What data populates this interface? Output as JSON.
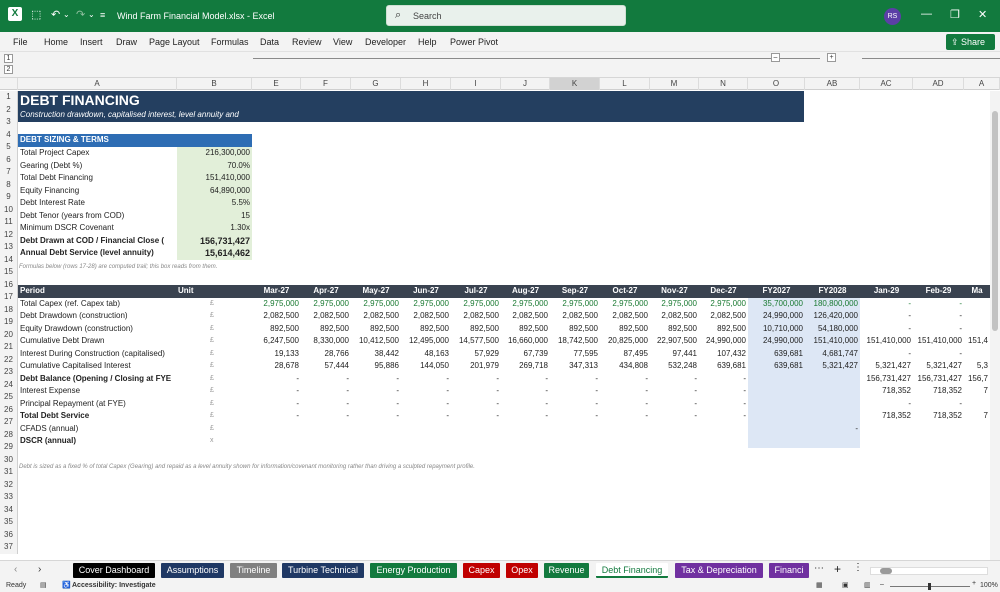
{
  "window": {
    "title": "Wind Farm Financial Model.xlsx  -  Excel",
    "avatar": "RS"
  },
  "search": {
    "placeholder": "Search"
  },
  "menu": [
    "File",
    "Home",
    "Insert",
    "Draw",
    "Page Layout",
    "Formulas",
    "Data",
    "Review",
    "View",
    "Developer",
    "Help",
    "Power Pivot"
  ],
  "share_label": "Share",
  "columns": [
    "A",
    "B",
    "E",
    "F",
    "G",
    "H",
    "I",
    "J",
    "K",
    "L",
    "M",
    "N",
    "O",
    "AB",
    "AC",
    "AD",
    "A"
  ],
  "selected_column": "K",
  "outline": {
    "levels": [
      "1",
      "2"
    ],
    "collapse": "–",
    "expand": "+"
  },
  "sheet": {
    "title": "DEBT FINANCING",
    "subtitle": "Construction drawdown, capitalised interest, level annuity and",
    "section_sizing": "DEBT SIZING & TERMS",
    "terms": [
      {
        "label": "Total Project Capex",
        "value": "216,300,000",
        "bold": false
      },
      {
        "label": "Gearing (Debt %)",
        "value": "70.0%",
        "bold": false
      },
      {
        "label": "Total Debt Financing",
        "value": "151,410,000",
        "bold": false
      },
      {
        "label": "Equity Financing",
        "value": "64,890,000",
        "bold": false
      },
      {
        "label": "Debt Interest Rate",
        "value": "5.5%",
        "bold": false
      },
      {
        "label": "Debt Tenor (years from COD)",
        "value": "15",
        "bold": false
      },
      {
        "label": "Minimum DSCR Covenant",
        "value": "1.30x",
        "bold": false
      },
      {
        "label": "Debt Drawn at COD / Financial Close (",
        "value": "156,731,427",
        "bold": true
      },
      {
        "label": "Annual Debt Service (level annuity)",
        "value": "15,614,462",
        "bold": true
      }
    ],
    "note_row14": "Formulas below (rows 17-28) are computed trail; this box reads from them.",
    "period_label": "Period",
    "unit_label": "Unit",
    "periods": [
      "Mar-27",
      "Apr-27",
      "May-27",
      "Jun-27",
      "Jul-27",
      "Aug-27",
      "Sep-27",
      "Oct-27",
      "Nov-27",
      "Dec-27",
      "FY2027",
      "FY2028",
      "Jan-29",
      "Feb-29",
      "Ma"
    ],
    "rows": [
      {
        "label": "Total Capex (ref. Capex tab)",
        "unit": "£",
        "bold": false,
        "green": true,
        "values": [
          "2,975,000",
          "2,975,000",
          "2,975,000",
          "2,975,000",
          "2,975,000",
          "2,975,000",
          "2,975,000",
          "2,975,000",
          "2,975,000",
          "2,975,000",
          "35,700,000",
          "180,800,000",
          "-",
          "-",
          ""
        ]
      },
      {
        "label": "Debt Drawdown (construction)",
        "unit": "£",
        "bold": false,
        "green": false,
        "values": [
          "2,082,500",
          "2,082,500",
          "2,082,500",
          "2,082,500",
          "2,082,500",
          "2,082,500",
          "2,082,500",
          "2,082,500",
          "2,082,500",
          "2,082,500",
          "24,990,000",
          "126,420,000",
          "-",
          "-",
          ""
        ]
      },
      {
        "label": "Equity Drawdown (construction)",
        "unit": "£",
        "bold": false,
        "green": false,
        "values": [
          "892,500",
          "892,500",
          "892,500",
          "892,500",
          "892,500",
          "892,500",
          "892,500",
          "892,500",
          "892,500",
          "892,500",
          "10,710,000",
          "54,180,000",
          "-",
          "-",
          ""
        ]
      },
      {
        "label": "Cumulative Debt Drawn",
        "unit": "£",
        "bold": false,
        "green": false,
        "values": [
          "6,247,500",
          "8,330,000",
          "10,412,500",
          "12,495,000",
          "14,577,500",
          "16,660,000",
          "18,742,500",
          "20,825,000",
          "22,907,500",
          "24,990,000",
          "24,990,000",
          "151,410,000",
          "151,410,000",
          "151,410,000",
          "151,4"
        ]
      },
      {
        "label": "Interest During Construction (capitalised)",
        "unit": "£",
        "bold": false,
        "green": false,
        "values": [
          "19,133",
          "28,766",
          "38,442",
          "48,163",
          "57,929",
          "67,739",
          "77,595",
          "87,495",
          "97,441",
          "107,432",
          "639,681",
          "4,681,747",
          "-",
          "-",
          ""
        ]
      },
      {
        "label": "Cumulative Capitalised Interest",
        "unit": "£",
        "bold": false,
        "green": false,
        "values": [
          "28,678",
          "57,444",
          "95,886",
          "144,050",
          "201,979",
          "269,718",
          "347,313",
          "434,808",
          "532,248",
          "639,681",
          "639,681",
          "5,321,427",
          "5,321,427",
          "5,321,427",
          "5,3"
        ]
      },
      {
        "label": "Debt Balance (Opening / Closing at FYE",
        "unit": "£",
        "bold": true,
        "green": false,
        "values": [
          "-",
          "-",
          "-",
          "-",
          "-",
          "-",
          "-",
          "-",
          "-",
          "-",
          "",
          "",
          "156,731,427",
          "156,731,427",
          "156,7"
        ]
      },
      {
        "label": "Interest Expense",
        "unit": "£",
        "bold": false,
        "green": false,
        "values": [
          "-",
          "-",
          "-",
          "-",
          "-",
          "-",
          "-",
          "-",
          "-",
          "-",
          "",
          "",
          "718,352",
          "718,352",
          "7"
        ]
      },
      {
        "label": "Principal Repayment (at FYE)",
        "unit": "£",
        "bold": false,
        "green": false,
        "values": [
          "-",
          "-",
          "-",
          "-",
          "-",
          "-",
          "-",
          "-",
          "-",
          "-",
          "",
          "",
          "-",
          "-",
          ""
        ]
      },
      {
        "label": "Total Debt Service",
        "unit": "£",
        "bold": true,
        "green": false,
        "values": [
          "-",
          "-",
          "-",
          "-",
          "-",
          "-",
          "-",
          "-",
          "-",
          "-",
          "",
          "",
          "718,352",
          "718,352",
          "7"
        ]
      },
      {
        "label": "CFADS (annual)",
        "unit": "£",
        "bold": false,
        "green": false,
        "values": [
          "",
          "",
          "",
          "",
          "",
          "",
          "",
          "",
          "",
          "",
          "",
          "-",
          "",
          "",
          ""
        ]
      },
      {
        "label": "DSCR (annual)",
        "unit": "x",
        "bold": true,
        "green": false,
        "values": [
          "",
          "",
          "",
          "",
          "",
          "",
          "",
          "",
          "",
          "",
          "",
          "",
          "",
          "",
          ""
        ]
      }
    ],
    "note_row30": "Debt is sized as a fixed % of total Capex (Gearing) and repaid as a level annuity shown for information/covenant monitoring rather than driving a sculpted repayment profile."
  },
  "row_numbers": [
    "1",
    "2",
    "3",
    "4",
    "5",
    "6",
    "7",
    "8",
    "9",
    "10",
    "11",
    "12",
    "13",
    "14",
    "15",
    "16",
    "17",
    "18",
    "19",
    "20",
    "21",
    "22",
    "23",
    "24",
    "25",
    "26",
    "27",
    "28",
    "29",
    "30",
    "31",
    "32",
    "33",
    "34",
    "35",
    "36",
    "37"
  ],
  "tabs": [
    {
      "label": "Cover Dashboard",
      "color": "#000000",
      "active": false
    },
    {
      "label": "Assumptions",
      "color": "#1f3864",
      "active": false
    },
    {
      "label": "Timeline",
      "color": "#808080",
      "active": false
    },
    {
      "label": "Turbine Technical",
      "color": "#1f3864",
      "active": false
    },
    {
      "label": "Energy Production",
      "color": "#127a3e",
      "active": false
    },
    {
      "label": "Capex",
      "color": "#c00000",
      "active": false
    },
    {
      "label": "Opex",
      "color": "#c00000",
      "active": false
    },
    {
      "label": "Revenue",
      "color": "#127a3e",
      "active": false
    },
    {
      "label": "Debt Financing",
      "color": "#f3f3f3",
      "active": true
    },
    {
      "label": "Tax & Depreciation",
      "color": "#7030a0",
      "active": false
    },
    {
      "label": "Financi",
      "color": "#7030a0",
      "active": false
    }
  ],
  "status": {
    "ready": "Ready",
    "accessibility": "Accessibility: Investigate",
    "zoom": "100%"
  }
}
